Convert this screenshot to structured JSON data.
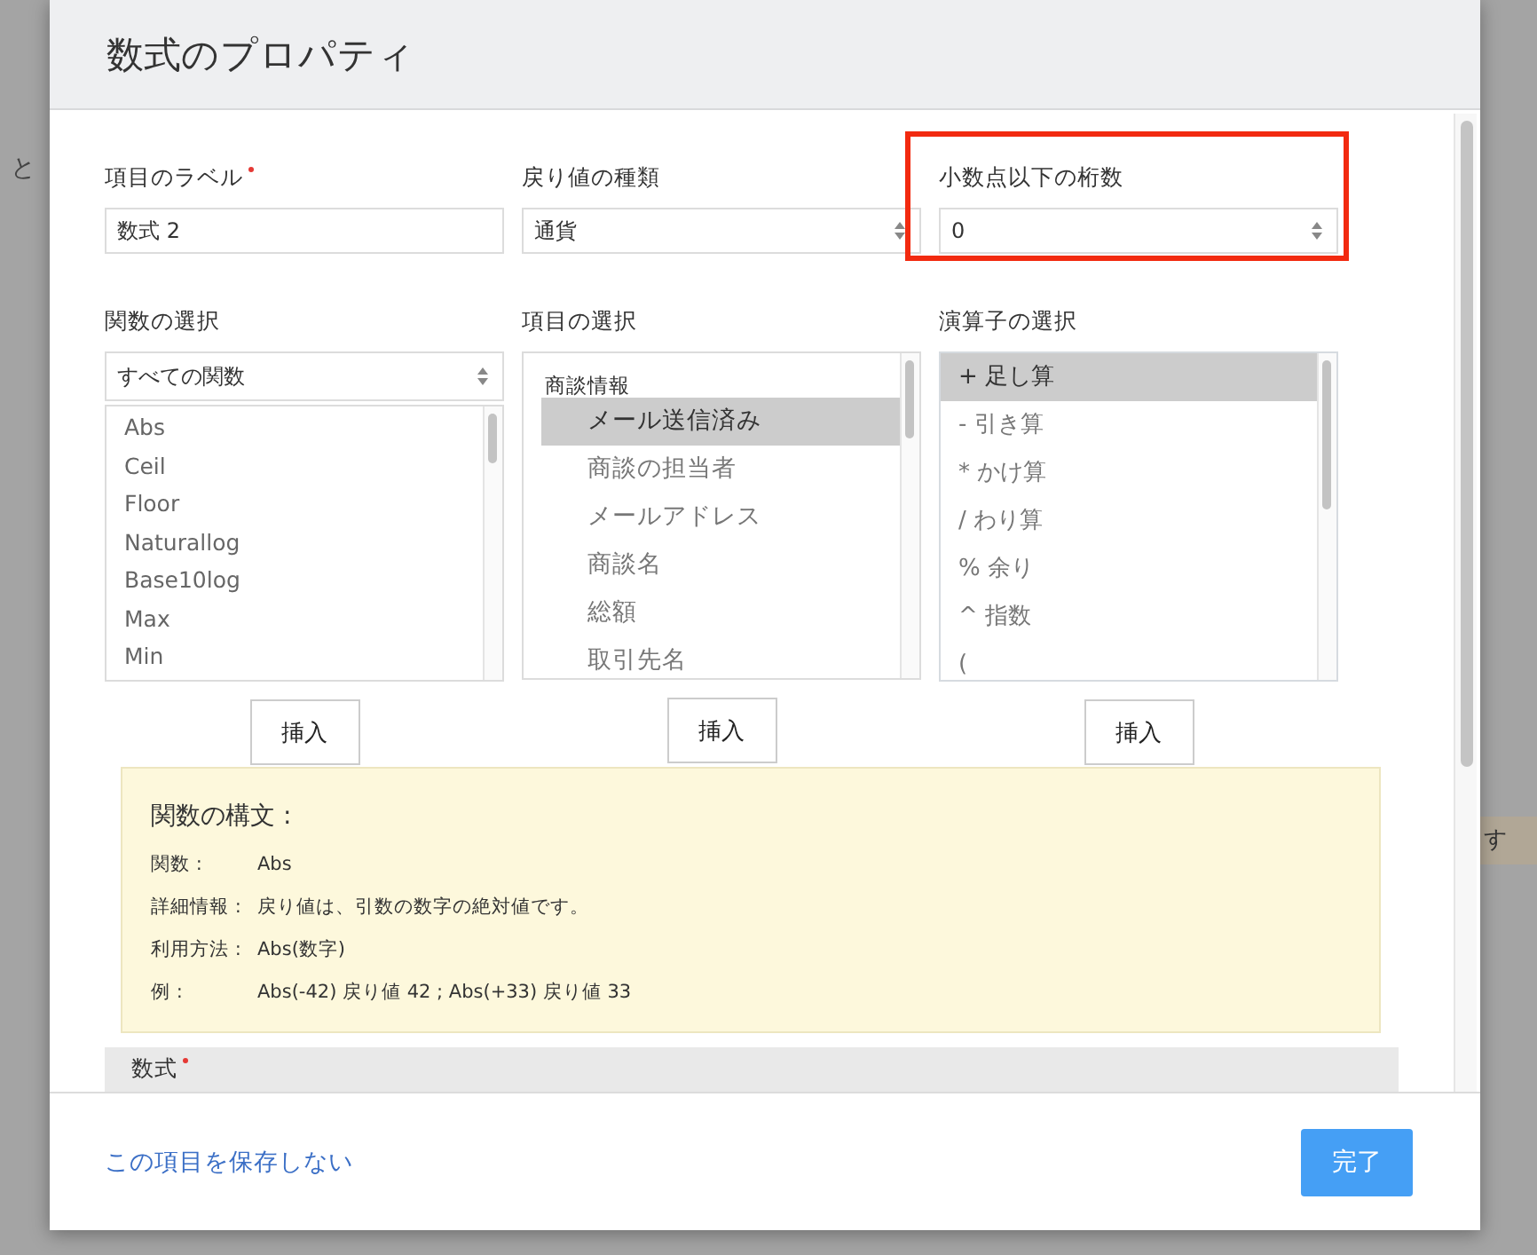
{
  "background": {
    "left_text": "と",
    "right_text": "す"
  },
  "dialog": {
    "title": "数式のプロパティ"
  },
  "fields": [
    {
      "label": "項目のラベル",
      "required": true,
      "kind": "text",
      "value": "数式 2",
      "highlighted": false
    },
    {
      "label": "戻り値の種類",
      "required": false,
      "kind": "select",
      "value": "通貨",
      "highlighted": false
    },
    {
      "label": "小数点以下の桁数",
      "required": false,
      "kind": "spinner",
      "value": "0",
      "highlighted": true
    }
  ],
  "pickers": [
    {
      "kind": "functions",
      "label": "関数の選択",
      "filter": "すべての関数",
      "insert_button": "挿入",
      "items": [
        {
          "label": "Abs",
          "selected": false
        },
        {
          "label": "Ceil",
          "selected": false
        },
        {
          "label": "Floor",
          "selected": false
        },
        {
          "label": "Naturallog",
          "selected": false
        },
        {
          "label": "Base10log",
          "selected": false
        },
        {
          "label": "Max",
          "selected": false
        },
        {
          "label": "Min",
          "selected": false
        }
      ]
    },
    {
      "kind": "fields",
      "label": "項目の選択",
      "group": "商談情報",
      "insert_button": "挿入",
      "items": [
        {
          "label": "メール送信済み",
          "selected": true
        },
        {
          "label": "商談の担当者",
          "selected": false
        },
        {
          "label": "メールアドレス",
          "selected": false
        },
        {
          "label": "商談名",
          "selected": false
        },
        {
          "label": "総額",
          "selected": false
        },
        {
          "label": "取引先名",
          "selected": false
        }
      ]
    },
    {
      "kind": "operators",
      "label": "演算子の選択",
      "insert_button": "挿入",
      "items": [
        {
          "label": "+ 足し算",
          "selected": true
        },
        {
          "label": "- 引き算",
          "selected": false
        },
        {
          "label": "* かけ算",
          "selected": false
        },
        {
          "label": "/ わり算",
          "selected": false
        },
        {
          "label": "% 余り",
          "selected": false
        },
        {
          "label": "^ 指数",
          "selected": false
        },
        {
          "label": "(",
          "selected": false
        }
      ]
    }
  ],
  "syntax": {
    "title": "関数の構文 :",
    "rows": [
      {
        "label": "関数 :",
        "value": "Abs"
      },
      {
        "label": "詳細情報 :",
        "value": "戻り値は、引数の数字の絶対値です。"
      },
      {
        "label": "利用方法 :",
        "value": "Abs(数字)"
      },
      {
        "label": "例 :",
        "value": "Abs(-42) 戻り値 42 ; Abs(+33) 戻り値 33"
      }
    ]
  },
  "formula": {
    "label": "数式",
    "required": true
  },
  "footer": {
    "discard_link": "この項目を保存しない",
    "done_button": "完了"
  }
}
